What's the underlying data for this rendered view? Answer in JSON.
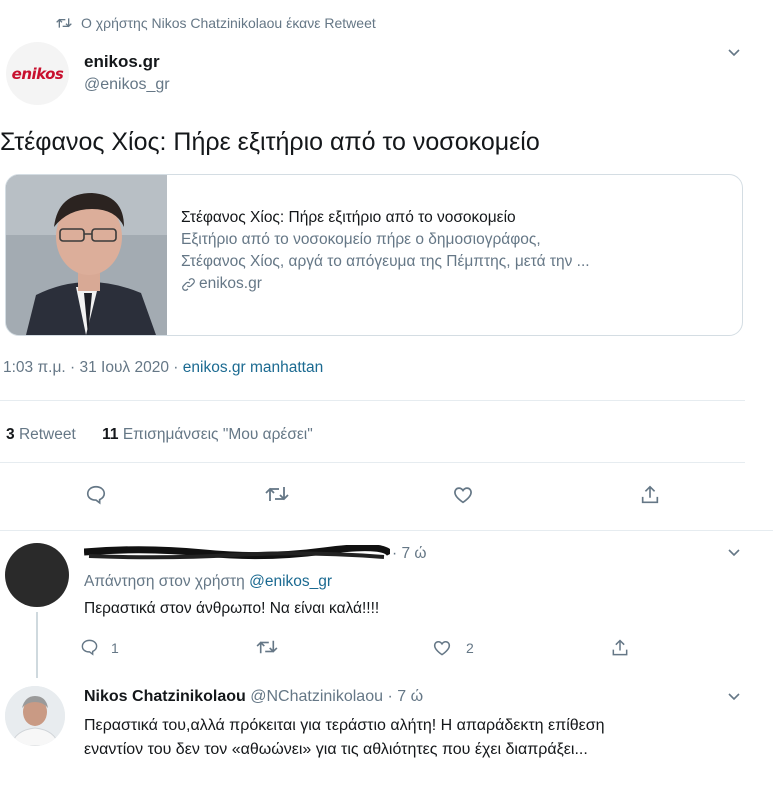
{
  "retweet_header": {
    "text": "Ο χρήστης Nikos Chatzinikolaou έκανε Retweet"
  },
  "main_tweet": {
    "logo_text": "enikos",
    "author_name": "enikos.gr",
    "author_handle": "@enikos_gr",
    "text": "Στέφανος Χίος: Πήρε εξιτήριο από το νοσοκομείο",
    "card": {
      "title": "Στέφανος Χίος: Πήρε εξιτήριο από το νοσοκομείο",
      "description_line1": "Εξιτήριο από το νοσοκομείο πήρε ο δημοσιογράφος,",
      "description_line2": "Στέφανος Χίος, αργά το απόγευμα της Πέμπτης, μετά την ...",
      "site": "enikos.gr"
    },
    "timestamp": "1:03 π.μ. · 31 Ιουλ 2020 ·",
    "source": "enikos.gr manhattan",
    "stats": {
      "retweets_count": "3",
      "retweets_label": "Retweet",
      "likes_count": "11",
      "likes_label": "Επισημάνσεις \"Μου αρέσει\""
    }
  },
  "replies": [
    {
      "time": "· 7 ώ",
      "replying_to_label": "Απάντηση στον χρήστη",
      "replying_to_handle": "@enikos_gr",
      "text": "Περαστικά στον άνθρωπο! Να είναι καλά!!!!",
      "reply_count": "1",
      "like_count": "2"
    },
    {
      "author_name": "Nikos Chatzinikolaou",
      "author_handle": "@NChatzinikolaou · 7 ώ",
      "text_line1": "Περαστικά του,αλλά πρόκειται για τεράστιο αλήτη! Η απαράδεκτη επίθεση",
      "text_line2": "εναντίον του δεν τον «αθωώνει» για τις αθλιότητες που έχει διαπράξει..."
    }
  ],
  "colors": {
    "link": "#1b6a91",
    "muted": "#657786",
    "logo": "#c8102e"
  }
}
